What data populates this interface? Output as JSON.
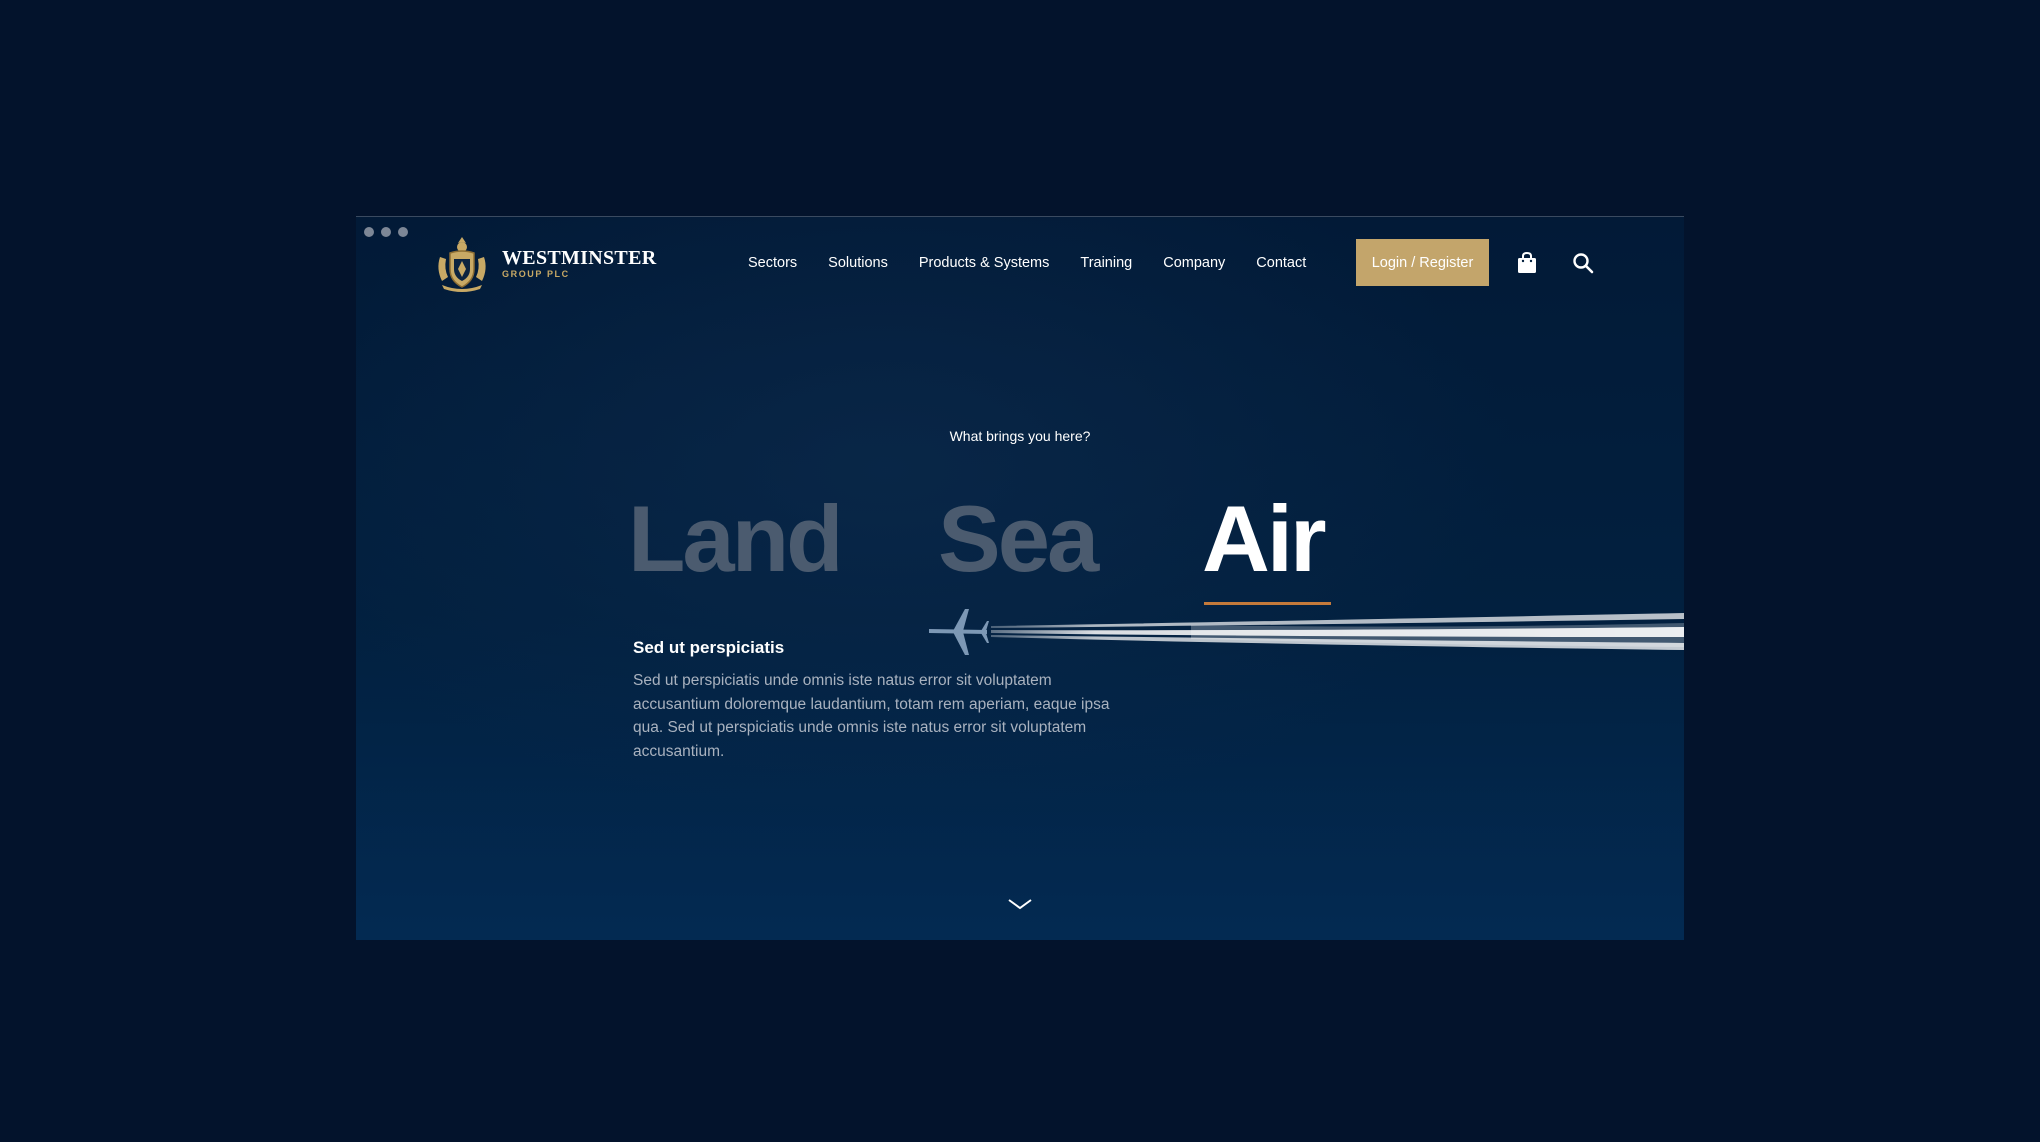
{
  "header": {
    "brand_name": "WESTMINSTER",
    "brand_sub": "GROUP PLC",
    "nav": [
      {
        "label": "Sectors"
      },
      {
        "label": "Solutions"
      },
      {
        "label": "Products & Systems"
      },
      {
        "label": "Training"
      },
      {
        "label": "Company"
      },
      {
        "label": "Contact"
      }
    ],
    "login_label": "Login / Register",
    "icons": [
      "shopping-bag-icon",
      "search-icon"
    ]
  },
  "hero": {
    "prompt": "What brings you here?",
    "tabs": [
      {
        "label": "Land",
        "active": false
      },
      {
        "label": "Sea",
        "active": false
      },
      {
        "label": "Air",
        "active": true
      }
    ],
    "content_title": "Sed ut perspiciatis",
    "content_body": "Sed ut perspiciatis unde omnis iste natus error sit voluptatem accusantium doloremque laudantium, totam rem aperiam, eaque ipsa qua. Sed ut perspiciatis unde omnis iste natus error sit voluptatem accusantium."
  },
  "colors": {
    "page_bg": "#03132c",
    "hero_bg": "#02203f",
    "accent_gold": "#c3a56b",
    "active_underline": "#c47a3b",
    "inactive_tab": "#4b5b6f"
  }
}
